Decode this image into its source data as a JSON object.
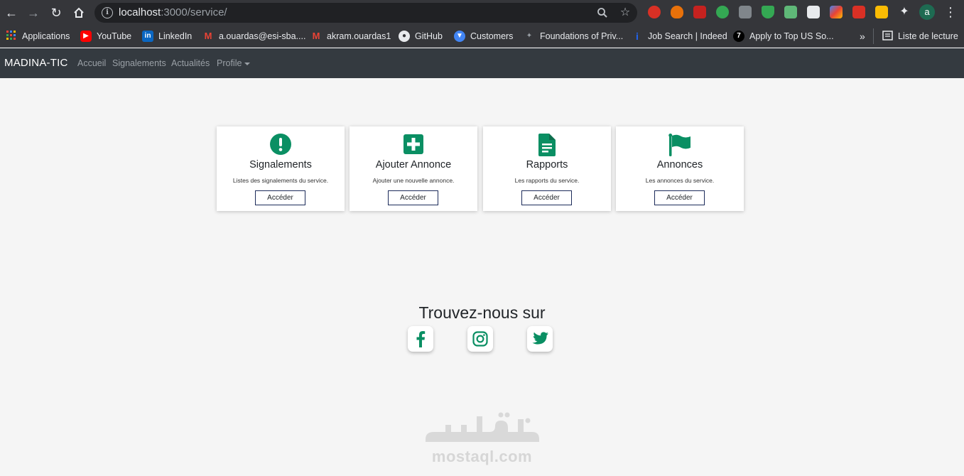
{
  "browser": {
    "url_host": "localhost",
    "url_rest": ":3000/service/",
    "bookmarks": [
      {
        "label": "Applications",
        "icon": "apps-grid-icon"
      },
      {
        "label": "YouTube",
        "icon": "youtube-icon"
      },
      {
        "label": "LinkedIn",
        "icon": "linkedin-icon"
      },
      {
        "label": "a.ouardas@esi-sba....",
        "icon": "gmail-icon"
      },
      {
        "label": "akram.ouardas1",
        "icon": "gmail-icon"
      },
      {
        "label": "GitHub",
        "icon": "github-icon"
      },
      {
        "label": "Customers",
        "icon": "customers-icon"
      },
      {
        "label": "Foundations of Priv...",
        "icon": "coursera-icon"
      },
      {
        "label": "Job Search | Indeed",
        "icon": "indeed-icon"
      },
      {
        "label": "Apply to Top US So...",
        "icon": "turing-icon"
      }
    ],
    "more_bookmarks": "»",
    "reading_list": "Liste de lecture",
    "profile_initial": "a"
  },
  "navbar": {
    "brand": "MADINA-TIC",
    "links": [
      "Accueil",
      "Signalements",
      "Actualités",
      "Profile"
    ]
  },
  "cards": [
    {
      "title": "Signalements",
      "description": "Listes des signalements du service.",
      "button": "Accéder",
      "icon": "exclamation-circle-icon"
    },
    {
      "title": "Ajouter Annonce",
      "description": "Ajouter une nouvelle annonce.",
      "button": "Accéder",
      "icon": "plus-square-icon"
    },
    {
      "title": "Rapports",
      "description": "Les rapports du service.",
      "button": "Accéder",
      "icon": "document-icon"
    },
    {
      "title": "Annonces",
      "description": "Les annonces du service.",
      "button": "Accéder",
      "icon": "flag-icon"
    }
  ],
  "social": {
    "title": "Trouvez-nous sur",
    "links": [
      "facebook-icon",
      "instagram-icon",
      "twitter-icon"
    ]
  },
  "watermark": {
    "arabic": "مستقل",
    "latin": "mostaql.com"
  },
  "colors": {
    "accent": "#0a8f63",
    "navbar_bg": "#343a40",
    "button_border": "#1c2b5a"
  }
}
